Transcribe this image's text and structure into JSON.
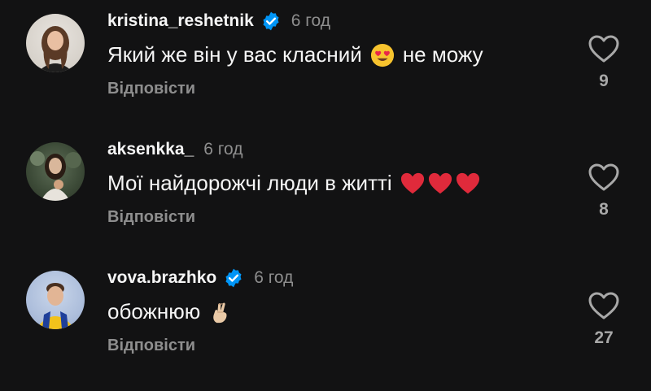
{
  "comments": [
    {
      "username": "kristina_reshetnik",
      "verified": true,
      "time": "6 год",
      "text": "Який же він у вас класний",
      "text_after": "не можу",
      "emoji": "heart-eyes-emoji",
      "reply_label": "Відповісти",
      "likes": "9"
    },
    {
      "username": "aksenkka_",
      "verified": false,
      "time": "6 год",
      "text": "Мої найдорожчі люди в житті",
      "emoji": "red-heart-emoji",
      "reply_label": "Відповісти",
      "likes": "8"
    },
    {
      "username": "vova.brazhko",
      "verified": true,
      "time": "6 год",
      "text": "обожнюю",
      "emoji": "crossed-fingers-emoji",
      "reply_label": "Відповісти",
      "likes": "27"
    }
  ],
  "colors": {
    "background": "#121213",
    "text": "#f5f5f5",
    "muted": "#8e8e8e",
    "verified": "#0095f6",
    "heart_red": "#e0245e"
  }
}
